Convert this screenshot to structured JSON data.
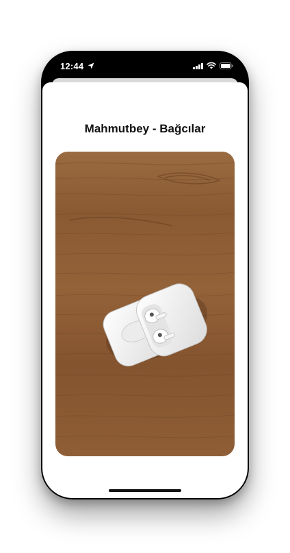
{
  "status_bar": {
    "time": "12:44",
    "location_icon": "location-arrow-icon",
    "signal_icon": "cellular-signal-icon",
    "wifi_icon": "wifi-icon",
    "battery_icon": "battery-icon"
  },
  "detail": {
    "title": "Mahmutbey - Bağcılar",
    "photo_subject": "airpods-case-photo"
  },
  "colors": {
    "background": "#ffffff",
    "device_frame": "#000000",
    "title_text": "#111111",
    "wood_base": "#8a5a33"
  }
}
